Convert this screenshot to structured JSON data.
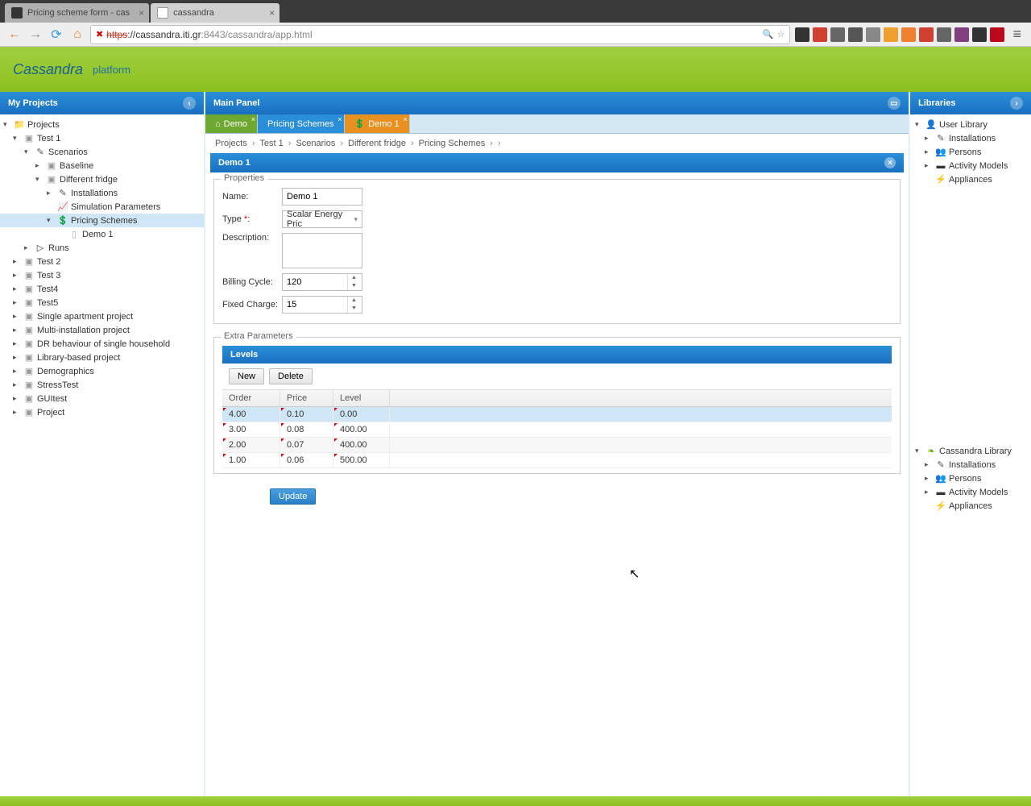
{
  "browser": {
    "tabs": [
      {
        "title": "Pricing scheme form - cas"
      },
      {
        "title": "cassandra"
      }
    ],
    "url_protocol": "https",
    "url_host": "://cassandra.iti.gr",
    "url_port_path": ":8443/cassandra/app.html"
  },
  "header": {
    "logo": "Cassandra",
    "platform": "platform"
  },
  "panels": {
    "left_title": "My Projects",
    "main_title": "Main Panel",
    "right_title": "Libraries"
  },
  "tree": {
    "root": "Projects",
    "test1": "Test 1",
    "scenarios": "Scenarios",
    "baseline": "Baseline",
    "diff_fridge": "Different fridge",
    "installations": "Installations",
    "sim_params": "Simulation Parameters",
    "pricing_schemes": "Pricing Schemes",
    "demo1": "Demo 1",
    "runs": "Runs",
    "test2": "Test 2",
    "test3": "Test 3",
    "test4": "Test4",
    "test5": "Test5",
    "single_apt": "Single apartment project",
    "multi_inst": "Multi-installation project",
    "dr_behaviour": "DR behaviour of single household",
    "library_based": "Library-based project",
    "demographics": "Demographics",
    "stresstest": "StressTest",
    "guitest": "GUItest",
    "project": "Project"
  },
  "main_tabs": {
    "demo": "Demo",
    "pricing": "Pricing Schemes",
    "demo1": "Demo 1"
  },
  "breadcrumb": {
    "projects": "Projects",
    "test1": "Test 1",
    "scenarios": "Scenarios",
    "diff_fridge": "Different fridge",
    "pricing": "Pricing Schemes",
    "sep": "›"
  },
  "form": {
    "title": "Demo 1",
    "properties_legend": "Properties",
    "name_label": "Name:",
    "name_value": "Demo 1",
    "type_label": "Type ",
    "type_req": "*",
    "type_colon": ":",
    "type_value": "Scalar Energy Pric",
    "desc_label": "Description:",
    "desc_value": "",
    "billing_label": "Billing Cycle:",
    "billing_value": "120",
    "fixed_label": "Fixed Charge:",
    "fixed_value": "15",
    "extra_legend": "Extra Parameters",
    "levels_title": "Levels",
    "new_btn": "New",
    "delete_btn": "Delete",
    "col_order": "Order",
    "col_price": "Price",
    "col_level": "Level",
    "rows": [
      {
        "order": "4.00",
        "price": "0.10",
        "level": "0.00"
      },
      {
        "order": "3.00",
        "price": "0.08",
        "level": "400.00"
      },
      {
        "order": "2.00",
        "price": "0.07",
        "level": "400.00"
      },
      {
        "order": "1.00",
        "price": "0.06",
        "level": "500.00"
      }
    ],
    "update_btn": "Update"
  },
  "libraries": {
    "user_library": "User Library",
    "installations": "Installations",
    "persons": "Persons",
    "activity_models": "Activity Models",
    "appliances": "Appliances",
    "cassandra_library": "Cassandra Library"
  }
}
